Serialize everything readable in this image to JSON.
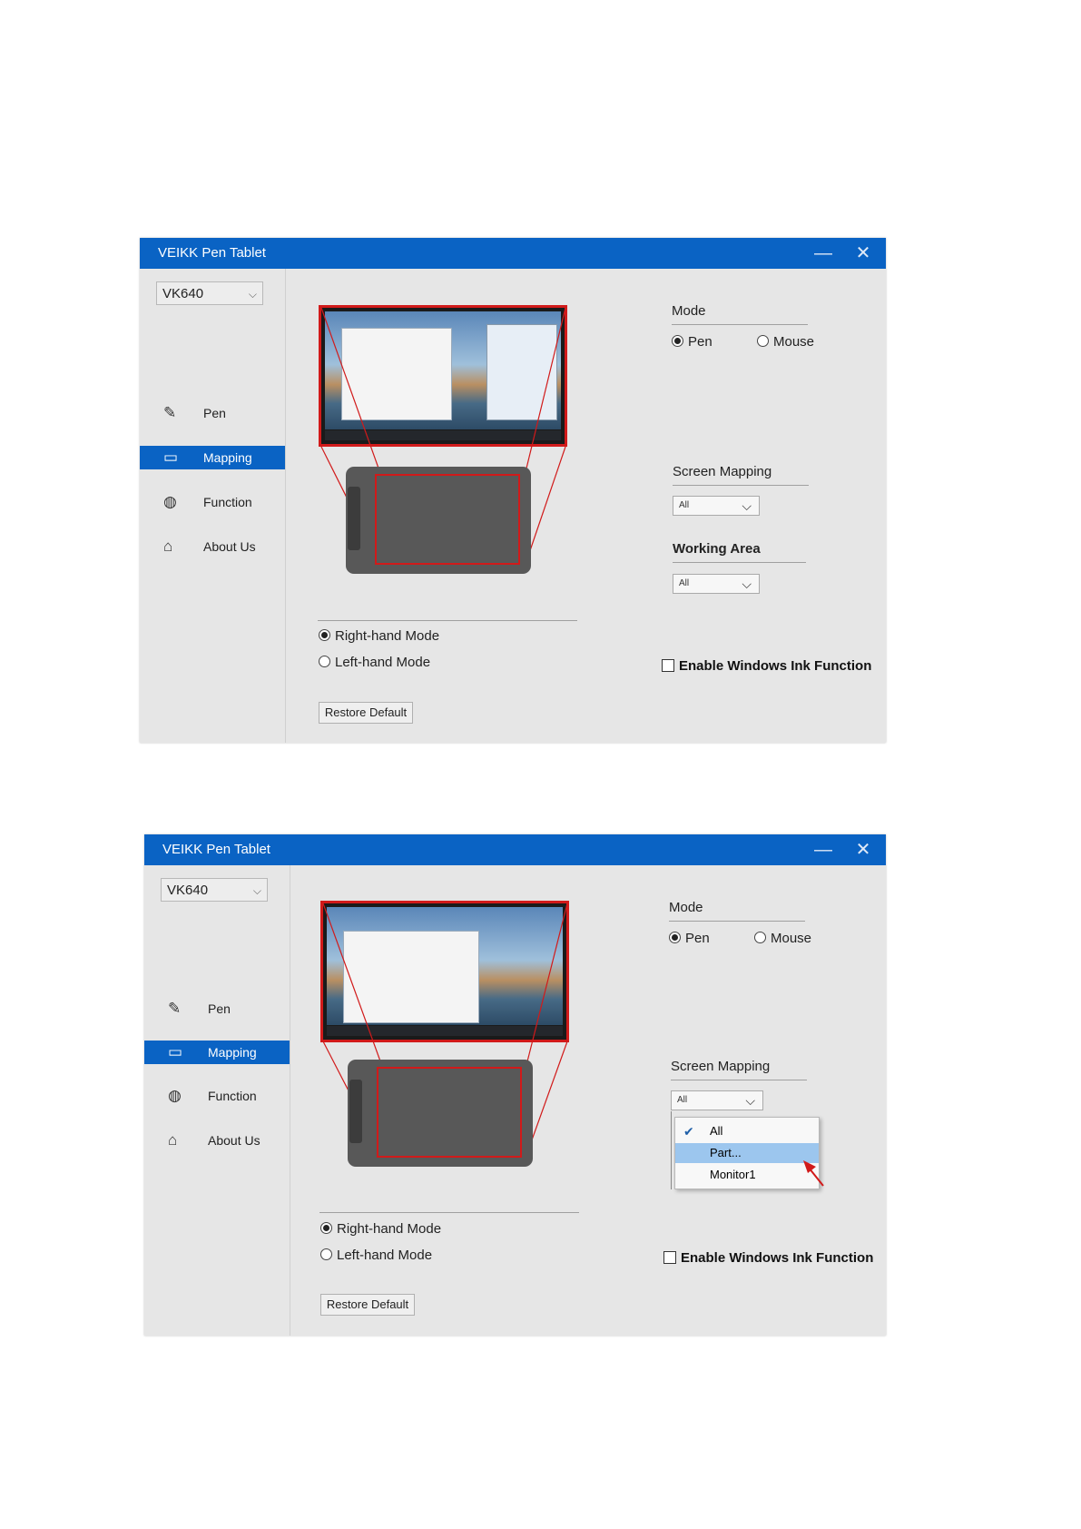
{
  "windows": [
    {
      "title": "VEIKK Pen Tablet",
      "minimize_label": "—",
      "close_label": "✕",
      "device": "VK640",
      "nav": [
        {
          "label": "Pen",
          "icon": "pen-icon"
        },
        {
          "label": "Mapping",
          "icon": "mapping-icon",
          "active": true
        },
        {
          "label": "Function",
          "icon": "function-icon"
        },
        {
          "label": "About Us",
          "icon": "home-icon"
        }
      ],
      "hand_modes": {
        "right": "Right-hand Mode",
        "left": "Left-hand Mode",
        "selected": "right"
      },
      "restore_label": "Restore Default",
      "mode": {
        "label": "Mode",
        "options": [
          "Pen",
          "Mouse"
        ],
        "selected": "Pen"
      },
      "screen_mapping": {
        "label": "Screen Mapping",
        "value": "All"
      },
      "working_area": {
        "label": "Working Area",
        "value": "All"
      },
      "windows_ink": {
        "label": "Enable Windows Ink Function",
        "checked": false
      }
    },
    {
      "title": "VEIKK Pen Tablet",
      "minimize_label": "—",
      "close_label": "✕",
      "device": "VK640",
      "nav": [
        {
          "label": "Pen",
          "icon": "pen-icon"
        },
        {
          "label": "Mapping",
          "icon": "mapping-icon",
          "active": true
        },
        {
          "label": "Function",
          "icon": "function-icon"
        },
        {
          "label": "About Us",
          "icon": "home-icon"
        }
      ],
      "hand_modes": {
        "right": "Right-hand Mode",
        "left": "Left-hand Mode",
        "selected": "right"
      },
      "restore_label": "Restore Default",
      "mode": {
        "label": "Mode",
        "options": [
          "Pen",
          "Mouse"
        ],
        "selected": "Pen"
      },
      "screen_mapping": {
        "label": "Screen Mapping",
        "value": "All",
        "dropdown_open": true,
        "options": [
          "All",
          "Part...",
          "Monitor1"
        ],
        "checked_option": "All",
        "highlighted_option": "Part..."
      },
      "windows_ink": {
        "label": "Enable Windows Ink Function",
        "checked": false
      }
    }
  ],
  "colors": {
    "titlebar": "#0a63c4",
    "accent_red": "#d11a1a",
    "window_bg": "#e6e6e6"
  }
}
